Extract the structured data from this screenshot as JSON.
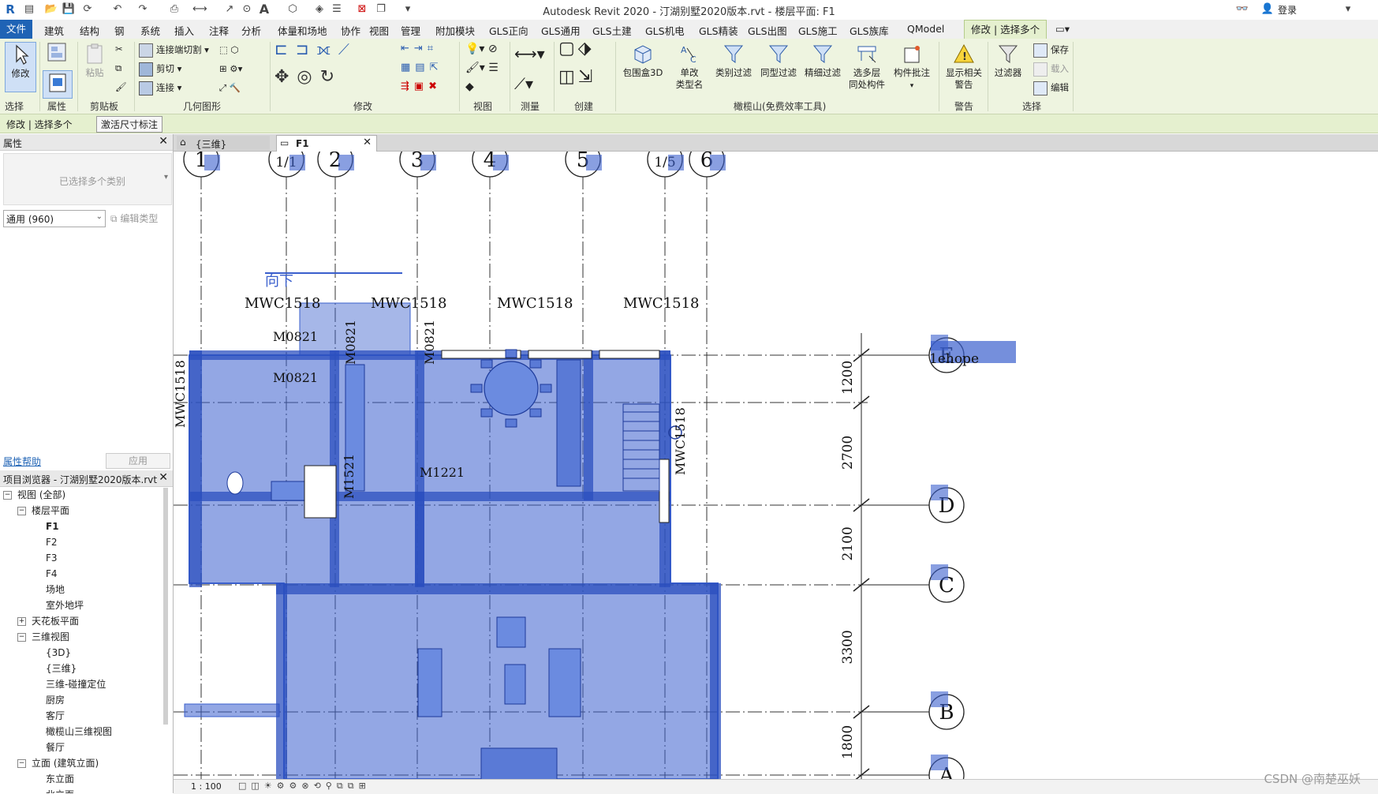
{
  "window": {
    "title": "Autodesk Revit 2020 - 汀湖别墅2020版本.rvt - 楼层平面: F1",
    "login_label": "登录"
  },
  "ribbon": {
    "tabs": [
      "文件",
      "建筑",
      "结构",
      "钢",
      "系统",
      "插入",
      "注释",
      "分析",
      "体量和场地",
      "协作",
      "视图",
      "管理",
      "附加模块",
      "GLS正向",
      "GLS通用",
      "GLS土建",
      "GLS机电",
      "GLS精装",
      "GLS出图",
      "GLS施工",
      "GLS族库",
      "QModel",
      "修改 | 选择多个"
    ],
    "active_tab": "修改 | 选择多个",
    "modify_label": "修改",
    "paste_label": "粘贴",
    "small_tools": {
      "join_cut": "连接端切割",
      "cut": "剪切",
      "join": "连接",
      "save": "保存",
      "load": "载入",
      "edit": "编辑"
    },
    "big_tools": {
      "box3d": "包围盒3D",
      "type_rename_1": "单改",
      "type_rename_2": "类型名",
      "category_filter": "类别过滤",
      "same_type_filter": "同型过滤",
      "fine_filter": "精细过滤",
      "multi_level_1": "选多层",
      "multi_level_2": "同处构件",
      "comp_note": "构件批注",
      "show_warn_1": "显示相关",
      "show_warn_2": "警告",
      "filter": "过滤器"
    },
    "group_labels": {
      "select": "选择",
      "properties": "属性",
      "clipboard": "剪贴板",
      "geometry": "几何图形",
      "modify": "修改",
      "view": "视图",
      "measure": "测量",
      "create": "创建",
      "olive": "橄榄山(免费效率工具)",
      "warning": "警告",
      "selection": "选择"
    }
  },
  "options_bar": {
    "context": "修改 | 选择多个",
    "activate_dim": "激活尺寸标注"
  },
  "properties_panel": {
    "title": "属性",
    "type_selector": "已选择多个类别",
    "filter_value": "通用 (960)",
    "edit_type": "编辑类型",
    "help_link": "属性帮助",
    "apply": "应用"
  },
  "project_browser": {
    "title": "项目浏览器 - 汀湖别墅2020版本.rvt",
    "items": [
      {
        "label": "视图 (全部)",
        "level": 0,
        "toggle": "-"
      },
      {
        "label": "楼层平面",
        "level": 1,
        "toggle": "-"
      },
      {
        "label": "F1",
        "level": 2,
        "bold": true
      },
      {
        "label": "F2",
        "level": 2
      },
      {
        "label": "F3",
        "level": 2
      },
      {
        "label": "F4",
        "level": 2
      },
      {
        "label": "场地",
        "level": 2
      },
      {
        "label": "室外地坪",
        "level": 2
      },
      {
        "label": "天花板平面",
        "level": 1,
        "toggle": "+"
      },
      {
        "label": "三维视图",
        "level": 1,
        "toggle": "-"
      },
      {
        "label": "{3D}",
        "level": 2
      },
      {
        "label": "{三维}",
        "level": 2
      },
      {
        "label": "三维-碰撞定位",
        "level": 2
      },
      {
        "label": "厨房",
        "level": 2
      },
      {
        "label": "客厅",
        "level": 2
      },
      {
        "label": "橄榄山三维视图",
        "level": 2
      },
      {
        "label": "餐厅",
        "level": 2
      },
      {
        "label": "立面 (建筑立面)",
        "level": 1,
        "toggle": "-"
      },
      {
        "label": "东立面",
        "level": 2
      },
      {
        "label": "北立面",
        "level": 2
      }
    ]
  },
  "view_tabs": [
    {
      "label": "{三维}",
      "active": false
    },
    {
      "label": "F1",
      "active": true
    }
  ],
  "plan": {
    "grid_top_labels": [
      "1",
      "1/1",
      "2",
      "3",
      "4",
      "5",
      "1/5",
      "6"
    ],
    "grid_right_labels": [
      "E",
      "D",
      "C",
      "B",
      "A"
    ],
    "dimensions": [
      "1200",
      "2700",
      "2100",
      "3300",
      "1800"
    ],
    "window_tags": [
      "MWC1518",
      "MWC1518",
      "MWC1518",
      "MWC1518",
      "MWC1518",
      "MWC1518"
    ],
    "door_tags": [
      "M0821",
      "M0821",
      "M0821",
      "M0821",
      "M1221",
      "M1521"
    ],
    "stair_label": "向下",
    "tag_text": "1ehope",
    "selection_color": "#3a5fcd"
  },
  "status": {
    "scale": "1 : 100"
  },
  "watermark": "CSDN @南楚巫妖"
}
